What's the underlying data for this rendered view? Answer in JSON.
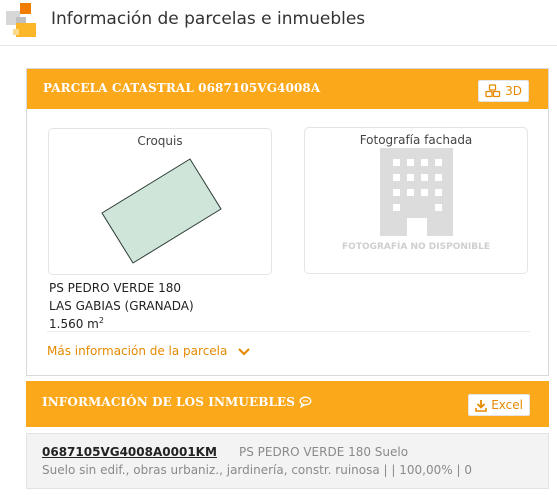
{
  "header": {
    "title": "Información de parcelas e inmuebles",
    "logo_icon": "cadastre-logo-icon"
  },
  "parcela": {
    "title": "PARCELA CATASTRAL 0687105VG4008A",
    "btn_3d": "3D",
    "croquis_label": "Croquis",
    "foto_label": "Fotografía fachada",
    "foto_unavailable": "FOTOGRAFÍA NO DISPONIBLE",
    "address_line1": "PS PEDRO VERDE 180",
    "address_line2": "LAS GABIAS (GRANADA)",
    "area_value": "1.560 m",
    "area_sup": "2",
    "more_info": "Más información de la parcela"
  },
  "inmuebles": {
    "title": "INFORMACIÓN DE LOS INMUEBLES",
    "excel_label": "Excel",
    "items": [
      {
        "ref": "0687105VG4008A0001KM",
        "address": "PS PEDRO VERDE 180 Suelo",
        "description": "Suelo sin edif., obras urbaniz., jardinería, constr. ruinosa | | 100,00% | 0"
      }
    ]
  },
  "colors": {
    "accent": "#fba81b",
    "link": "#e58a00",
    "parcel_fill": "#cfe5d9"
  }
}
